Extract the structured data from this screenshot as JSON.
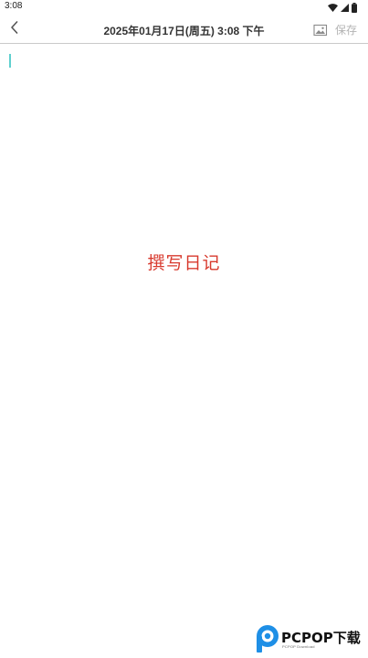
{
  "status_bar": {
    "time": "3:08",
    "icons": [
      "wifi-icon",
      "signal-icon",
      "battery-icon"
    ]
  },
  "header": {
    "title": "2025年01月17日(周五) 3:08 下午",
    "back_icon": "chevron-left-icon",
    "image_icon": "image-icon",
    "save_label": "保存"
  },
  "editor": {
    "placeholder": "撰写日记",
    "caret_color": "#5fd0cf",
    "placeholder_color": "#d83a2e"
  },
  "watermark": {
    "title": "PCPOP下载",
    "subtitle": "PCPOP Download",
    "brand_color": "#1e8fe6"
  }
}
